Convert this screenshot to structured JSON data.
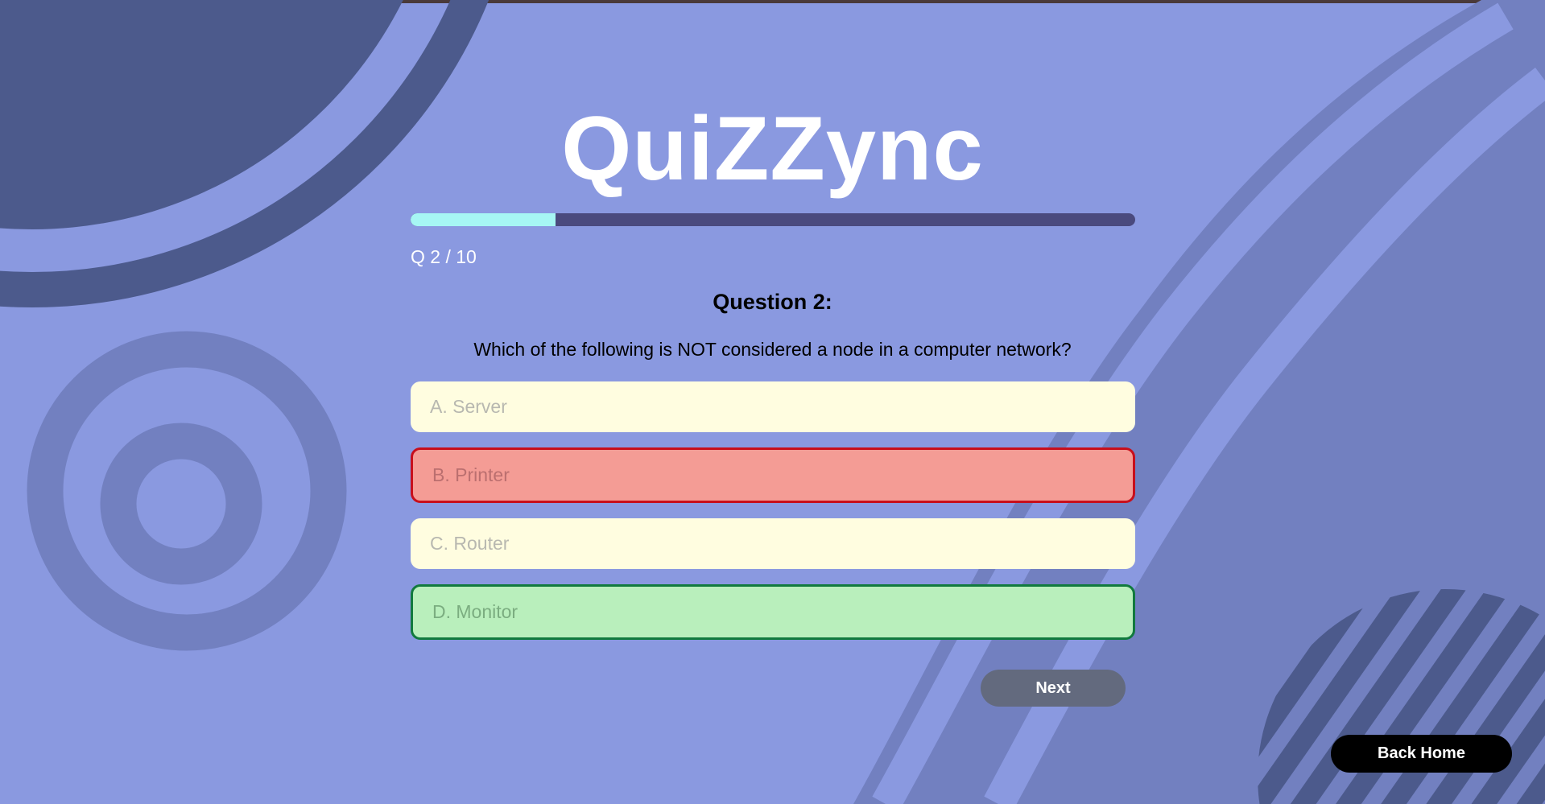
{
  "app": {
    "title": "QuiZZync"
  },
  "progress": {
    "fraction": 0.2,
    "counter_text": "Q 2 / 10"
  },
  "question": {
    "heading": "Question 2:",
    "text": "Which of the following is NOT considered a node in a computer network?"
  },
  "options": [
    {
      "label": "A. Server",
      "state": "neutral"
    },
    {
      "label": "B. Printer",
      "state": "wrong"
    },
    {
      "label": "C. Router",
      "state": "neutral"
    },
    {
      "label": "D. Monitor",
      "state": "correct"
    }
  ],
  "buttons": {
    "next_label": "Next",
    "back_home_label": "Back Home"
  },
  "colors": {
    "background": "#8a99e0",
    "progress_fill": "#a6f6f4",
    "progress_track": "#4a4a7e",
    "option_neutral": "#fffde0",
    "option_wrong": "#f49c95",
    "option_correct": "#b9efbc"
  }
}
